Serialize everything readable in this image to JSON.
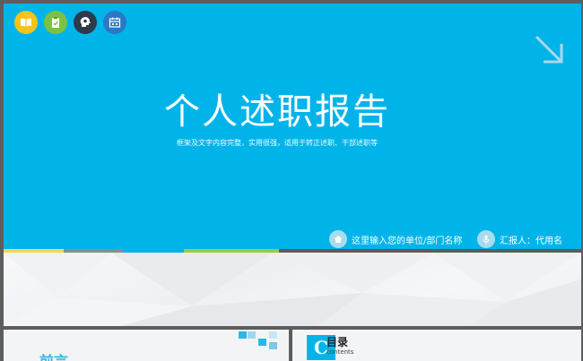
{
  "slide": {
    "title": "个人述职报告",
    "subtitle": "框架及文字内容完整，实用很强，适用于转正述职、干部述职等",
    "unit_label": "这里输入您的单位/部门名称",
    "reporter_label": "汇报人：代用名"
  },
  "top_icons": [
    {
      "name": "book-icon",
      "color": "#f7c21a"
    },
    {
      "name": "clipboard-check-icon",
      "color": "#7cc242"
    },
    {
      "name": "head-lightbulb-icon",
      "color": "#2d3a4a"
    },
    {
      "name": "calendar-icon",
      "color": "#2b78c4"
    }
  ],
  "stripe_colors": [
    "#f9d25b",
    "#8c8c8c",
    "#00b4ea",
    "#8ccf4a"
  ],
  "thumbnails": {
    "left_title": "前言",
    "right_badge": "C",
    "right_title": "目录",
    "right_sub": "contents"
  },
  "colors": {
    "hero_bg": "#00b4ea",
    "accent": "#2ab8e6"
  }
}
